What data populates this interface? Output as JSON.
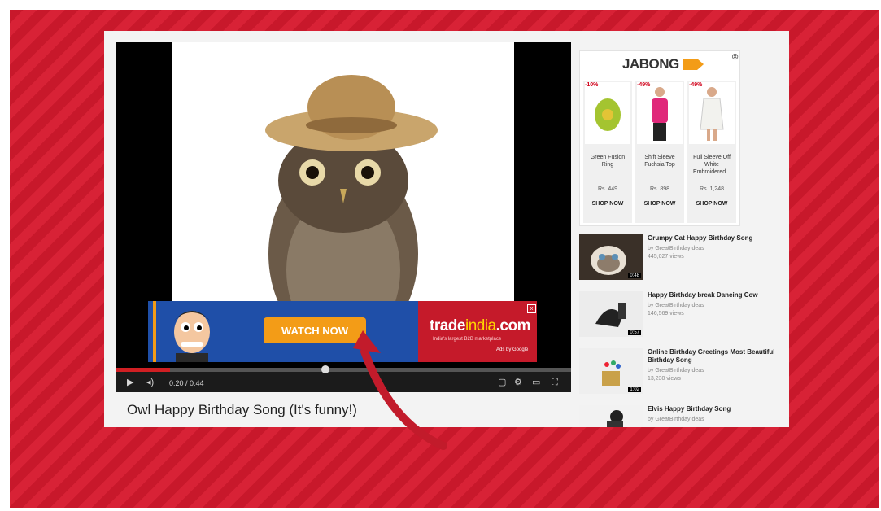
{
  "player": {
    "time_current": "0:20",
    "time_sep": " / ",
    "time_total": "0:44",
    "progress_fraction": 0.46,
    "watched_fraction": 0.12
  },
  "ad": {
    "cta_label": "WATCH NOW",
    "advertiser_part1": "trade",
    "advertiser_part2": "india",
    "advertiser_part3": ".com",
    "tagline": "India's largest B2B marketplace",
    "ads_by": "Ads by Google",
    "close_glyph": "x"
  },
  "video": {
    "title": "Owl Happy Birthday Song (It's funny!)"
  },
  "jabong": {
    "brand": "JABONG",
    "close_glyph": "⊗",
    "products": [
      {
        "discount": "-10%",
        "name": "Green Fusion Ring",
        "price": "Rs. 449",
        "cta": "SHOP NOW"
      },
      {
        "discount": "-49%",
        "name": "Shift Sleeve Fuchsia Top",
        "price": "Rs. 898",
        "cta": "SHOP NOW"
      },
      {
        "discount": "-49%",
        "name": "Full Sleeve Off White Embroidered...",
        "price": "Rs. 1,248",
        "cta": "SHOP NOW"
      }
    ]
  },
  "related": [
    {
      "title": "Grumpy Cat Happy Birthday Song",
      "channel": "by GreatBirthdayIdeas",
      "views": "445,027 views",
      "duration": "0:48"
    },
    {
      "title": "Happy Birthday break Dancing Cow",
      "channel": "by GreatBirthdayIdeas",
      "views": "146,569 views",
      "duration": "0:57"
    },
    {
      "title": "Online Birthday Greetings Most Beautiful Birthday Song",
      "channel": "by GreatBirthdayIdeas",
      "views": "13,230 views",
      "duration": "1:02"
    },
    {
      "title": "Elvis Happy Birthday Song",
      "channel": "by GreatBirthdayIdeas",
      "views": "",
      "duration": ""
    }
  ],
  "colors": {
    "background_red": "#c8182b",
    "progress_red": "#d01f23",
    "cta_orange": "#f39c17",
    "ad_blue": "#1f4fa8"
  }
}
